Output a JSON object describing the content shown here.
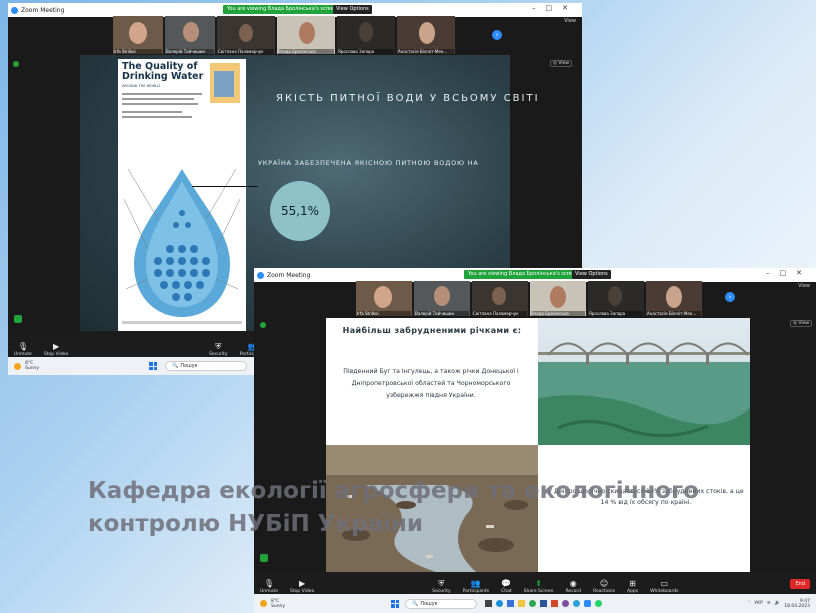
{
  "window1": {
    "title": "Zoom Meeting",
    "viewing_banner": "You are viewing Влада Бролінська's screen",
    "view_options": "View Options",
    "view_label": "View",
    "participants": [
      {
        "name": "Irfa Strilkoi"
      },
      {
        "name": "Валерій Тайчишин"
      },
      {
        "name": "Світлана Паламарчук"
      },
      {
        "name": "Влада Бролінська"
      },
      {
        "name": "Ярослава Запара"
      },
      {
        "name": "Анастасія Ейлліт-Мен..."
      }
    ],
    "slide": {
      "poster_title_line1": "The Quality of",
      "poster_title_line2": "Drinking Water",
      "poster_subtitle": "AROUND THE WORLD",
      "heading": "ЯКІСТЬ ПИТНОЇ ВОДИ У ВСЬОМУ СВІТІ",
      "subheading": "УКРАЇНА ЗАБЕЗПЕЧЕНА ЯКІСНОЮ ПИТНОЮ ВОДОЮ НА",
      "percent": "55,1%",
      "percent_value": 55.1
    },
    "toolbar": [
      {
        "icon": "mic-icon",
        "label": "Unmute"
      },
      {
        "icon": "video-icon",
        "label": "Stop Video"
      },
      {
        "icon": "shield-icon",
        "label": "Security"
      },
      {
        "icon": "participants-icon",
        "label": "Participants"
      }
    ],
    "weather": {
      "temp": "8°C",
      "desc": "Sunny"
    },
    "search_label": "Пошук"
  },
  "window2": {
    "title": "Zoom Meeting",
    "viewing_banner": "You are viewing Влада Бролінська's screen",
    "view_options": "View Options",
    "view_label": "View",
    "participants": [
      {
        "name": "Irfa Strilkoi"
      },
      {
        "name": "Валерій Тайчишин"
      },
      {
        "name": "Світлана Паламарчук"
      },
      {
        "name": "Влада Бролінська"
      },
      {
        "name": "Ярослава Запара"
      },
      {
        "name": "Анастасія Ейлліт-Мен..."
      }
    ],
    "slide": {
      "heading": "Найбільш забрудненими річками є:",
      "body": "Південний Буг та Інгулець, а також річки Донецької і Дніпропетровської областей та Чорноморського узбережжя півдня України.",
      "stat_line1": "У Дніпро щорічно скидається 14% забруднених стоків, а це 14 % від їх обсягу по країні.",
      "stat_highlight": "14 %"
    },
    "toolbar": [
      {
        "icon": "mic-icon",
        "label": "Unmute"
      },
      {
        "icon": "video-icon",
        "label": "Stop Video"
      },
      {
        "icon": "shield-icon",
        "label": "Security"
      },
      {
        "icon": "participants-icon",
        "label": "Participants",
        "count": "17"
      },
      {
        "icon": "chat-icon",
        "label": "Chat"
      },
      {
        "icon": "share-icon",
        "label": "Share Screen"
      },
      {
        "icon": "record-icon",
        "label": "Record"
      },
      {
        "icon": "reactions-icon",
        "label": "Reactions"
      },
      {
        "icon": "apps-icon",
        "label": "Apps"
      },
      {
        "icon": "whiteboard-icon",
        "label": "Whiteboards"
      }
    ],
    "end_label": "End",
    "weather": {
      "temp": "8°C",
      "desc": "Sunny"
    },
    "search_label": "Пошук",
    "tray": {
      "lang": "УКР",
      "time": "9:47",
      "date": "18.04.2023"
    }
  },
  "watermark": {
    "line1": "Кафедра екології агросфери та екологічного",
    "line2": "контролю НУБіП України"
  },
  "colors": {
    "zoom_blue": "#2d8cff",
    "banner_green": "#1fa33a",
    "end_red": "#e02828",
    "slide_teal": "#8fc1c8",
    "heading_text": "#2a3a44"
  }
}
